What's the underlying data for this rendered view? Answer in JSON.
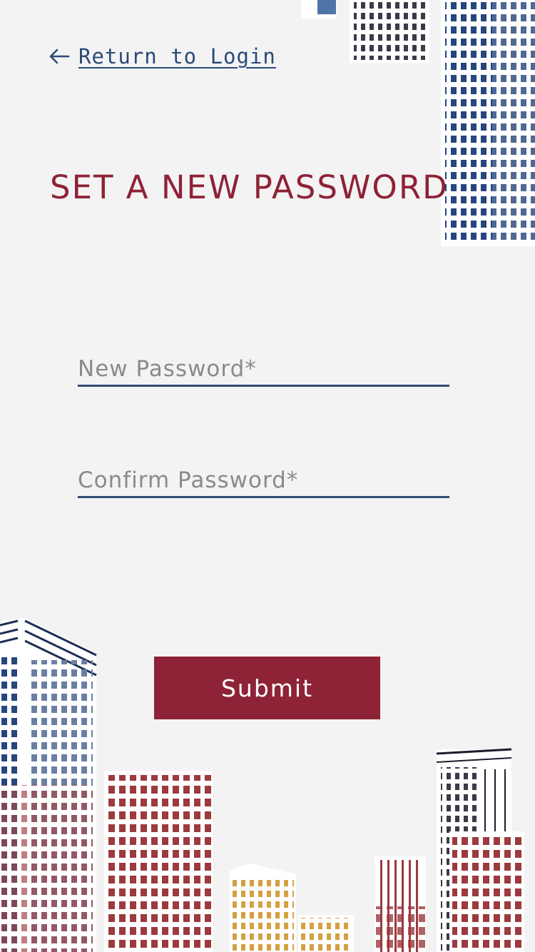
{
  "back_link": {
    "label": "Return to Login",
    "icon": "arrow-left-icon"
  },
  "page": {
    "title": "SET A NEW PASSWORD"
  },
  "form": {
    "new_password": {
      "placeholder": "New Password*",
      "value": ""
    },
    "confirm_password": {
      "placeholder": "Confirm Password*",
      "value": ""
    },
    "submit_label": "Submit"
  },
  "colors": {
    "accent": "#8e2236",
    "link": "#2a4a78",
    "underline": "#2f4d75",
    "background": "#f3f3f3"
  }
}
